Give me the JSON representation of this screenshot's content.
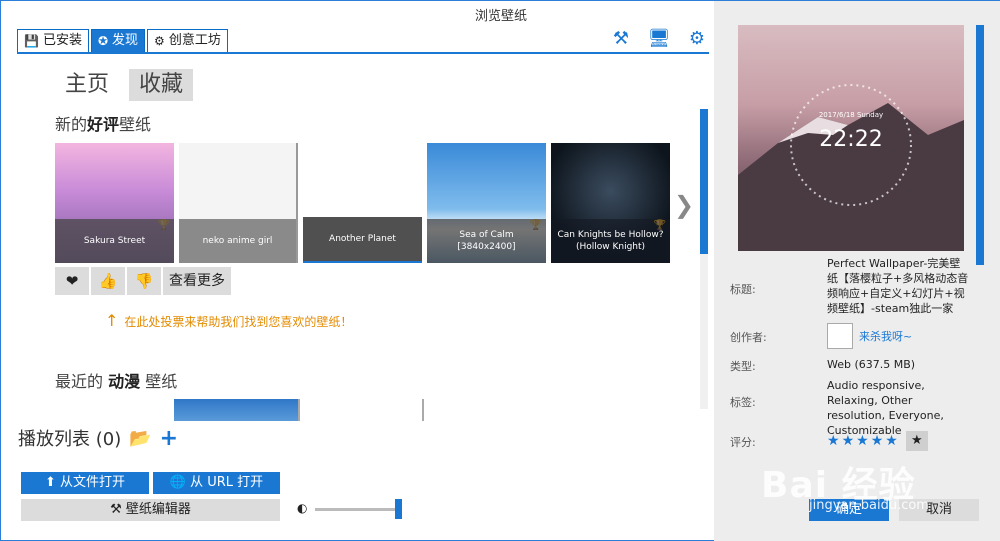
{
  "window": {
    "title": "浏览壁纸",
    "min_label": "—",
    "max_label": "☐",
    "close_label": "✕"
  },
  "tabs": [
    {
      "label": "已安装",
      "icon": "save-icon"
    },
    {
      "label": "发现",
      "icon": "compass-icon"
    },
    {
      "label": "创意工坊",
      "icon": "steam-icon"
    }
  ],
  "top_icons": [
    "editor-tools-icon",
    "display-icon",
    "settings-gear-icon"
  ],
  "subnav": {
    "home": "主页",
    "favorites": "收藏"
  },
  "popular": {
    "title_pre": "新的",
    "title_bold": "好评",
    "title_post": "壁纸",
    "items": [
      {
        "caption": "Sakura Street"
      },
      {
        "caption": "neko anime girl"
      },
      {
        "caption": "Another Planet"
      },
      {
        "caption": "Sea of Calm [3840x2400]"
      },
      {
        "caption": "Can Knights be Hollow? (Hollow Knight)"
      }
    ]
  },
  "vote": {
    "more": "查看更多",
    "hint": "在此处投票来帮助我们找到您喜欢的壁纸！"
  },
  "recent": {
    "title_pre": "最近的",
    "title_bold": "动漫",
    "title_post": "壁纸"
  },
  "playlist": {
    "label": "播放列表 (0)"
  },
  "buttons": {
    "open_file": "从文件打开",
    "open_url": "从 URL 打开",
    "editor": "壁纸编辑器",
    "ok": "确定",
    "cancel": "取消"
  },
  "preview": {
    "clock_time": "22:22",
    "clock_date": "2017/6/18 Sunday"
  },
  "details": {
    "title_label": "标题:",
    "title_value": "Perfect Wallpaper-完美壁纸【落樱粒子+多风格动态音频响应+自定义+幻灯片+视频壁纸】-steam独此一家",
    "author_label": "创作者:",
    "author_name": "来杀我呀~",
    "type_label": "类型:",
    "type_value": "Web (637.5 MB)",
    "tags_label": "标签:",
    "tags_value": "Audio responsive, Relaxing, Other resolution, Everyone, Customizable",
    "rating_label": "评分:",
    "rating": 5,
    "rating_max": 5
  },
  "watermark": {
    "main": "Bai 经验",
    "sub": "jingyan.baidu.com"
  },
  "colors": {
    "accent": "#1a78d3",
    "hint": "#e38b00",
    "close": "#e81123"
  }
}
